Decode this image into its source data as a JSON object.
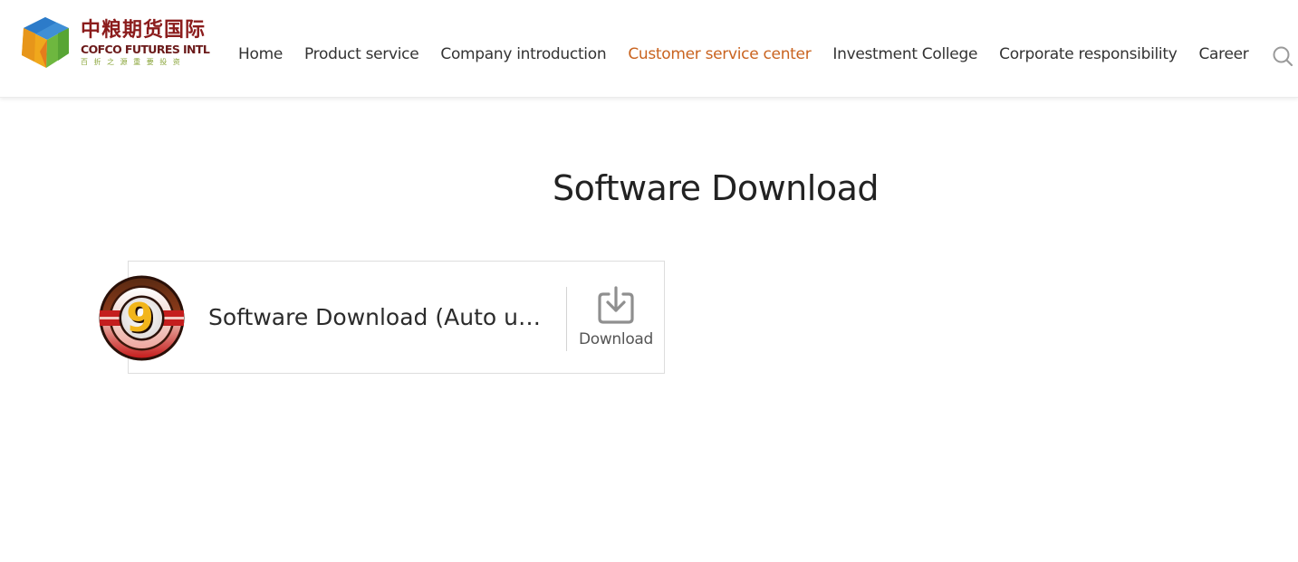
{
  "header": {
    "logo": {
      "cn_name": "中粮期货国际",
      "en_name": "COFCO FUTURES INTL",
      "slogan": "百 折 之 源   重 要 投 资"
    },
    "nav": [
      {
        "label": "Home",
        "active": false
      },
      {
        "label": "Product service",
        "active": false
      },
      {
        "label": "Company introduction",
        "active": false
      },
      {
        "label": "Customer service center",
        "active": true
      },
      {
        "label": "Investment College",
        "active": false
      },
      {
        "label": "Corporate responsibility",
        "active": false
      },
      {
        "label": "Career",
        "active": false
      }
    ],
    "search_icon": "search-icon"
  },
  "main": {
    "title": "Software Download",
    "items": [
      {
        "title": "Software Download (Auto update)",
        "icon": "app-icon-9",
        "action_label": "Download",
        "action_icon": "download-icon"
      }
    ]
  },
  "colors": {
    "active_nav": "#c9631f",
    "text": "#333333",
    "border": "#dddddd"
  }
}
